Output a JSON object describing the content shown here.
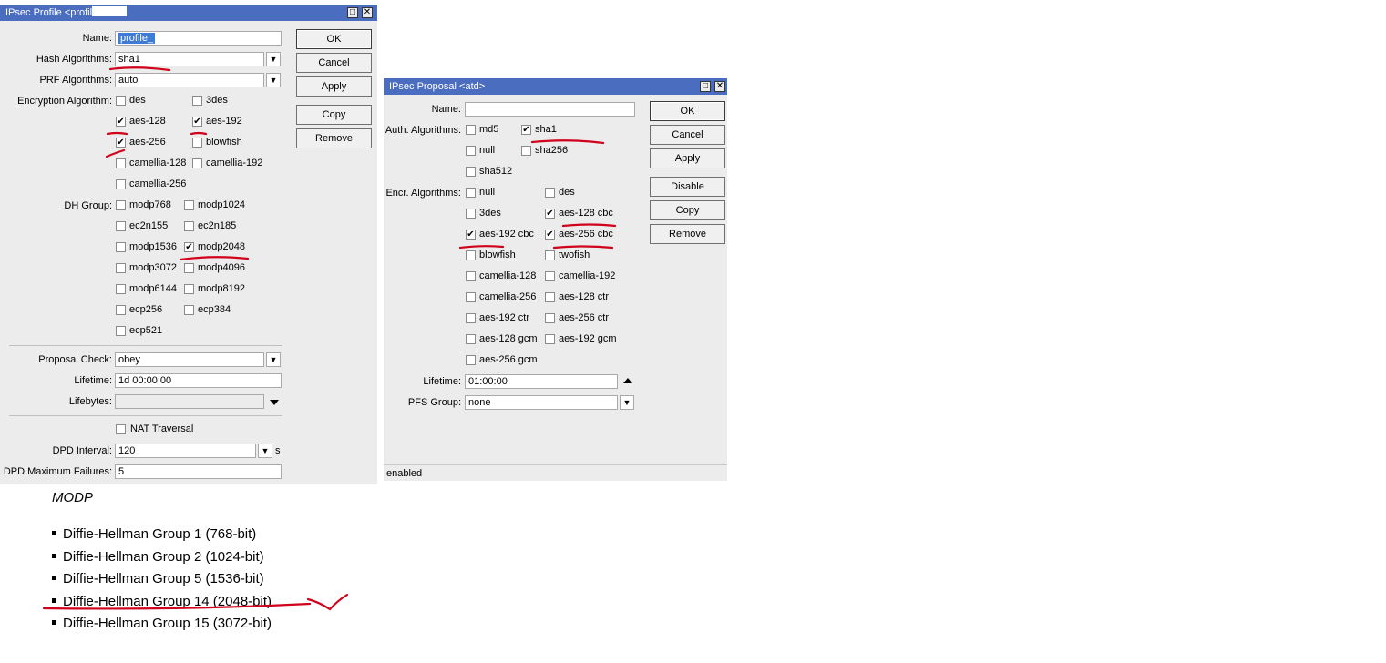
{
  "profile": {
    "title": "IPsec Profile <profil",
    "name_label": "Name:",
    "name_value": "profile_",
    "hash_label": "Hash Algorithms:",
    "hash_value": "sha1",
    "prf_label": "PRF Algorithms:",
    "prf_value": "auto",
    "enc_label": "Encryption Algorithm:",
    "enc_options": [
      {
        "label": "des",
        "checked": false
      },
      {
        "label": "3des",
        "checked": false
      },
      {
        "label": "aes-128",
        "checked": true
      },
      {
        "label": "aes-192",
        "checked": true
      },
      {
        "label": "aes-256",
        "checked": true
      },
      {
        "label": "blowfish",
        "checked": false
      },
      {
        "label": "camellia-128",
        "checked": false
      },
      {
        "label": "camellia-192",
        "checked": false
      },
      {
        "label": "camellia-256",
        "checked": false
      }
    ],
    "dh_label": "DH Group:",
    "dh_options": [
      {
        "label": "modp768",
        "checked": false
      },
      {
        "label": "modp1024",
        "checked": false
      },
      {
        "label": "ec2n155",
        "checked": false
      },
      {
        "label": "ec2n185",
        "checked": false
      },
      {
        "label": "modp1536",
        "checked": false
      },
      {
        "label": "modp2048",
        "checked": true
      },
      {
        "label": "modp3072",
        "checked": false
      },
      {
        "label": "modp4096",
        "checked": false
      },
      {
        "label": "modp6144",
        "checked": false
      },
      {
        "label": "modp8192",
        "checked": false
      },
      {
        "label": "ecp256",
        "checked": false
      },
      {
        "label": "ecp384",
        "checked": false
      },
      {
        "label": "ecp521",
        "checked": false
      }
    ],
    "proposal_check_label": "Proposal Check:",
    "proposal_check_value": "obey",
    "lifetime_label": "Lifetime:",
    "lifetime_value": "1d 00:00:00",
    "lifebytes_label": "Lifebytes:",
    "lifebytes_value": "",
    "nat_label": "NAT Traversal",
    "nat_checked": false,
    "dpd_interval_label": "DPD Interval:",
    "dpd_interval_value": "120",
    "dpd_unit": "s",
    "dpd_max_label": "DPD Maximum Failures:",
    "dpd_max_value": "5",
    "buttons": {
      "ok": "OK",
      "cancel": "Cancel",
      "apply": "Apply",
      "copy": "Copy",
      "remove": "Remove"
    }
  },
  "proposal": {
    "title": "IPsec Proposal <atd>",
    "name_label": "Name:",
    "name_value": "",
    "auth_label": "Auth. Algorithms:",
    "auth_options": [
      {
        "label": "md5",
        "checked": false
      },
      {
        "label": "sha1",
        "checked": true
      },
      {
        "label": "null",
        "checked": false
      },
      {
        "label": "sha256",
        "checked": false
      },
      {
        "label": "sha512",
        "checked": false
      }
    ],
    "encr_label": "Encr. Algorithms:",
    "encr_options": [
      {
        "label": "null",
        "checked": false
      },
      {
        "label": "des",
        "checked": false
      },
      {
        "label": "3des",
        "checked": false
      },
      {
        "label": "aes-128 cbc",
        "checked": true
      },
      {
        "label": "aes-192 cbc",
        "checked": true
      },
      {
        "label": "aes-256 cbc",
        "checked": true
      },
      {
        "label": "blowfish",
        "checked": false
      },
      {
        "label": "twofish",
        "checked": false
      },
      {
        "label": "camellia-128",
        "checked": false
      },
      {
        "label": "camellia-192",
        "checked": false
      },
      {
        "label": "camellia-256",
        "checked": false
      },
      {
        "label": "aes-128 ctr",
        "checked": false
      },
      {
        "label": "aes-192 ctr",
        "checked": false
      },
      {
        "label": "aes-256 ctr",
        "checked": false
      },
      {
        "label": "aes-128 gcm",
        "checked": false
      },
      {
        "label": "aes-192 gcm",
        "checked": false
      },
      {
        "label": "aes-256 gcm",
        "checked": false
      }
    ],
    "lifetime_label": "Lifetime:",
    "lifetime_value": "01:00:00",
    "pfs_label": "PFS Group:",
    "pfs_value": "none",
    "status": "enabled",
    "buttons": {
      "ok": "OK",
      "cancel": "Cancel",
      "apply": "Apply",
      "disable": "Disable",
      "copy": "Copy",
      "remove": "Remove"
    }
  },
  "modp": {
    "title": "MODP",
    "groups": [
      "Diffie-Hellman Group 1 (768-bit)",
      "Diffie-Hellman Group 2 (1024-bit)",
      "Diffie-Hellman Group 5 (1536-bit)",
      "Diffie-Hellman Group 14 (2048-bit)",
      "Diffie-Hellman Group 15 (3072-bit)"
    ]
  },
  "colors": {
    "titlebar": "#4b6dbf",
    "window_bg": "#ececec",
    "annotation": "#d0021b",
    "selection": "#3d7bd6"
  }
}
